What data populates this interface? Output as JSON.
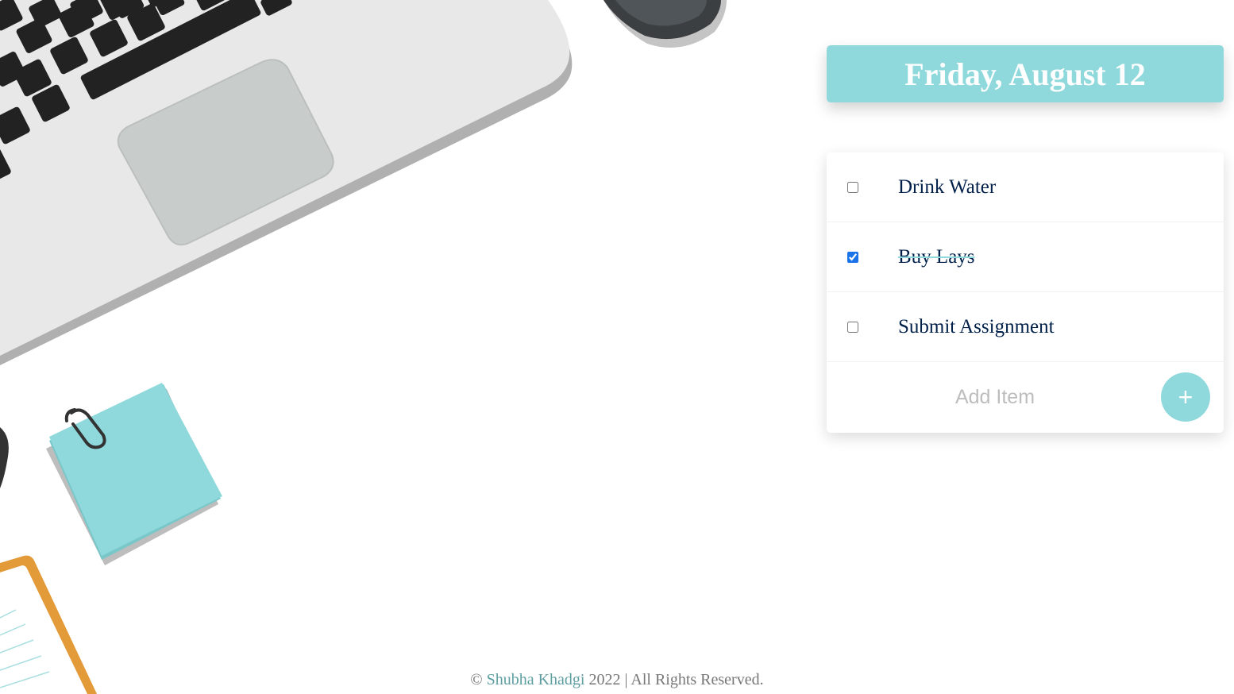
{
  "heading": {
    "date_title": "Friday, August 12"
  },
  "todo": {
    "items": [
      {
        "label": "Drink Water",
        "checked": false
      },
      {
        "label": "Buy Lays",
        "checked": true
      },
      {
        "label": "Submit Assignment",
        "checked": false
      }
    ],
    "new_item_placeholder": "Add Item",
    "add_button_label": "+"
  },
  "footer": {
    "copyright_symbol": "©",
    "author": "Shubha Khadgi",
    "rest": "2022 | All Rights Reserved."
  },
  "colors": {
    "accent": "#8fd9dc",
    "item_text": "#00204a",
    "footer_link": "#5e9ea1"
  }
}
